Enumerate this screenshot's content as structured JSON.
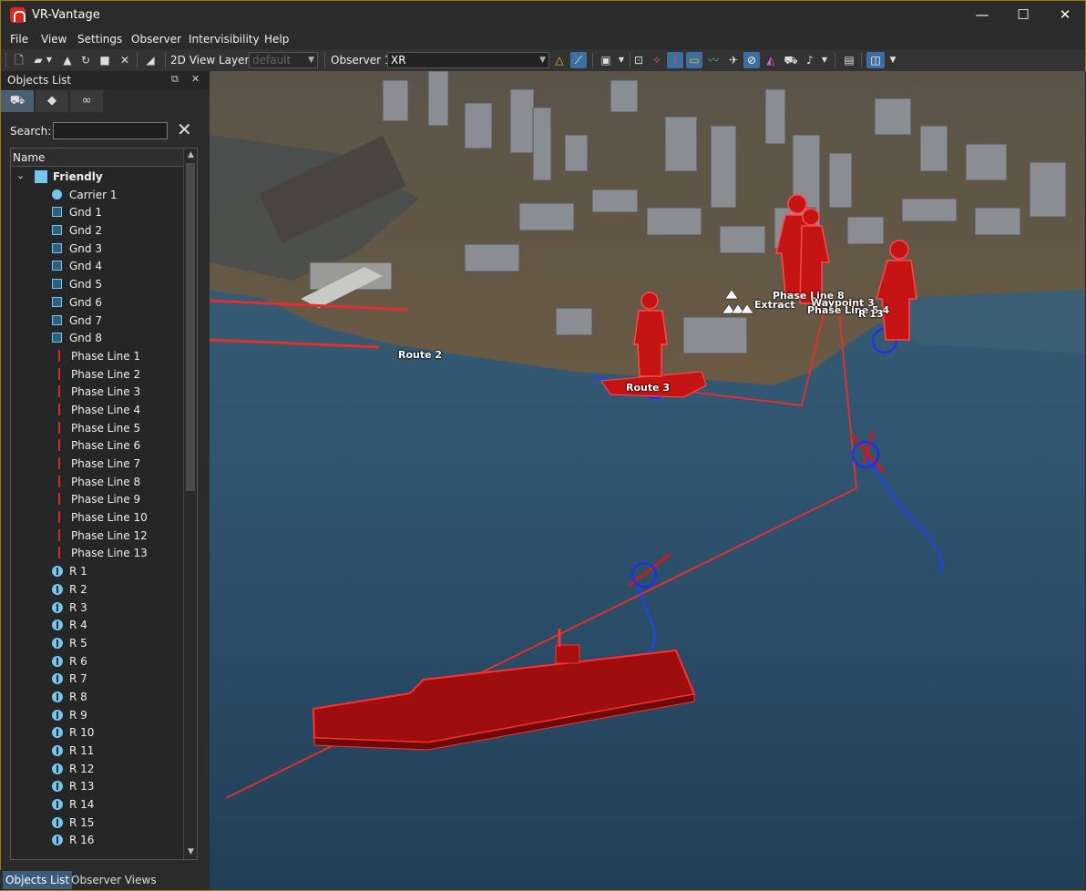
{
  "app": {
    "title": "VR-Vantage"
  },
  "window_controls": {
    "minimize": "—",
    "maximize": "☐",
    "close": "✕"
  },
  "menu": [
    "File",
    "View",
    "Settings",
    "Observer",
    "Intervisibility",
    "Help"
  ],
  "toolbar": {
    "view_layer_label": "2D View Layer:",
    "view_layer_value": "default",
    "observer_label": "Observer 1",
    "observer_value": "XR"
  },
  "objects_panel": {
    "title": "Objects List",
    "search_label": "Search:",
    "search_value": "",
    "column_header": "Name",
    "group": "Friendly",
    "items": [
      {
        "kind": "carrier",
        "label": "Carrier 1"
      },
      {
        "kind": "gnd",
        "label": "Gnd 1"
      },
      {
        "kind": "gnd",
        "label": "Gnd 2"
      },
      {
        "kind": "gnd",
        "label": "Gnd 3"
      },
      {
        "kind": "gnd",
        "label": "Gnd 4"
      },
      {
        "kind": "gnd",
        "label": "Gnd 5"
      },
      {
        "kind": "gnd",
        "label": "Gnd 6"
      },
      {
        "kind": "gnd",
        "label": "Gnd 7"
      },
      {
        "kind": "gnd",
        "label": "Gnd 8"
      },
      {
        "kind": "phase",
        "label": "Phase Line 1"
      },
      {
        "kind": "phase",
        "label": "Phase Line 2"
      },
      {
        "kind": "phase",
        "label": "Phase Line 3"
      },
      {
        "kind": "phase",
        "label": "Phase Line 4"
      },
      {
        "kind": "phase",
        "label": "Phase Line 5"
      },
      {
        "kind": "phase",
        "label": "Phase Line 6"
      },
      {
        "kind": "phase",
        "label": "Phase Line 7"
      },
      {
        "kind": "phase",
        "label": "Phase Line 8"
      },
      {
        "kind": "phase",
        "label": "Phase Line 9"
      },
      {
        "kind": "phase",
        "label": "Phase Line 10"
      },
      {
        "kind": "phase",
        "label": "Phase Line 12"
      },
      {
        "kind": "phase",
        "label": "Phase Line 13"
      },
      {
        "kind": "r",
        "label": "R 1"
      },
      {
        "kind": "r",
        "label": "R 2"
      },
      {
        "kind": "r",
        "label": "R 3"
      },
      {
        "kind": "r",
        "label": "R 4"
      },
      {
        "kind": "r",
        "label": "R 5"
      },
      {
        "kind": "r",
        "label": "R 6"
      },
      {
        "kind": "r",
        "label": "R 7"
      },
      {
        "kind": "r",
        "label": "R 8"
      },
      {
        "kind": "r",
        "label": "R 9"
      },
      {
        "kind": "r",
        "label": "R 10"
      },
      {
        "kind": "r",
        "label": "R 11"
      },
      {
        "kind": "r",
        "label": "R 12"
      },
      {
        "kind": "r",
        "label": "R 13"
      },
      {
        "kind": "r",
        "label": "R 14"
      },
      {
        "kind": "r",
        "label": "R 15"
      },
      {
        "kind": "r",
        "label": "R 16"
      }
    ]
  },
  "bottom_tabs": [
    "Objects List",
    "Observer Views"
  ],
  "scene": {
    "labels": {
      "route2": "Route 2",
      "route3": "Route 3",
      "phase_line": "Phase Line 8",
      "waypoint": "Waypoint 3",
      "phase_line_5_4": "Phase Line 5 4",
      "extract": "Extract",
      "r13": "R 13"
    }
  },
  "colors": {
    "accent": "#3c6ea0",
    "friendly": "#72c7ee",
    "hostile_red": "#c51414",
    "route_red": "#e03030"
  }
}
